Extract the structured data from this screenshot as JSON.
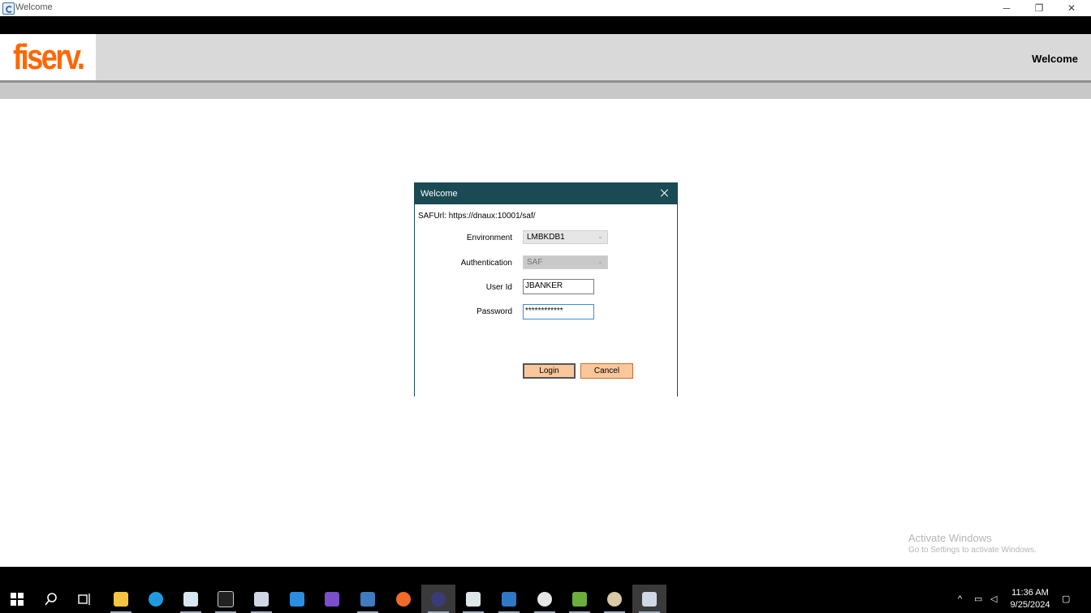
{
  "window": {
    "title": "Welcome",
    "controls": {
      "minimize": "─",
      "restore": "❐",
      "close": "✕"
    }
  },
  "header": {
    "logo": "fiserv.",
    "title": "Welcome",
    "brand_color": "#ff6600"
  },
  "dialog": {
    "title": "Welcome",
    "saf_url": "SAFUrl: https://dnaux:10001/saf/",
    "environment": {
      "label": "Environment",
      "value": "LMBKDB1"
    },
    "authentication": {
      "label": "Authentication",
      "value": "SAF"
    },
    "user_id": {
      "label": "User Id",
      "value": "JBANKER"
    },
    "password": {
      "label": "Password",
      "value": "************"
    },
    "login_label": "Login",
    "cancel_label": "Cancel",
    "title_color": "#1a4b55",
    "button_color": "#fac79c"
  },
  "watermark": {
    "line1": "Activate Windows",
    "line2": "Go to Settings to activate Windows."
  },
  "taskbar": {
    "icons": [
      "start-icon",
      "search-icon",
      "task-view-icon",
      "file-explorer-icon",
      "edge-icon",
      "media-app-icon",
      "terminal-icon",
      "app-icon",
      "vscode-icon",
      "visual-studio-icon",
      "document-icon",
      "compass-icon",
      "eclipse-icon",
      "window-app-icon",
      "remote-app-icon",
      "cloud-app-icon",
      "chart-app-icon",
      "paint-icon",
      "welcome-app-icon"
    ],
    "time": "11:36 AM",
    "date": "9/25/2024"
  }
}
